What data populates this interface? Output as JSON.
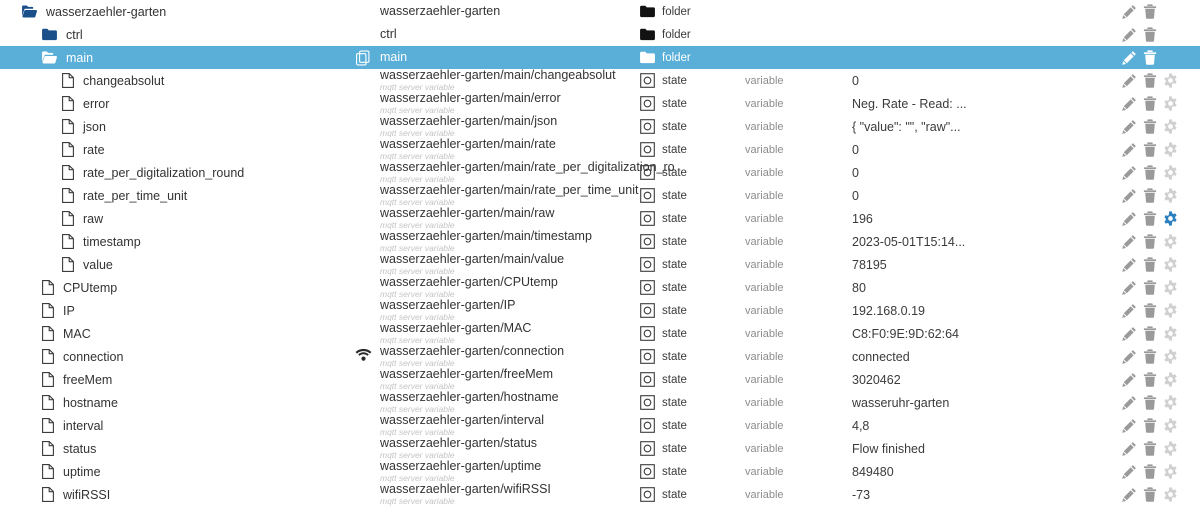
{
  "theme": {
    "selected_row_bg": "#5aafd8",
    "folder_icon_color": "#1b4f8a",
    "folder_icon_color_selected": "#ffffff",
    "action_icon_color": "#9a9a9a",
    "action_icon_active_color": "#2a7fbf",
    "subtitle_color": "#c4c4c4"
  },
  "labels": {
    "type_folder": "folder",
    "type_state": "state",
    "role_variable": "variable",
    "subtitle_mqtt": "mqtt server variable"
  },
  "icons": {
    "folder_open": "folder-open-icon",
    "folder_closed": "folder-closed-icon",
    "file": "file-icon",
    "copy": "copy-icon",
    "wifi": "wifi-icon",
    "state": "state-icon",
    "edit": "edit-pencil-icon",
    "delete": "trash-icon",
    "settings": "gear-icon"
  },
  "rows": [
    {
      "name": "wasserzaehler-garten",
      "id": "wasserzaehler-garten",
      "subtitle": "",
      "indent": 0,
      "node_icon": "folder-open-icon",
      "type": "folder",
      "role": "",
      "value": "",
      "selected": false,
      "has_settings": false,
      "settings_active": false,
      "leading_icon": ""
    },
    {
      "name": "ctrl",
      "id": "ctrl",
      "subtitle": "",
      "indent": 1,
      "node_icon": "folder-closed-icon",
      "type": "folder",
      "role": "",
      "value": "",
      "selected": false,
      "has_settings": false,
      "settings_active": false,
      "leading_icon": ""
    },
    {
      "name": "main",
      "id": "main",
      "subtitle": "",
      "indent": 1,
      "node_icon": "folder-open-icon",
      "type": "folder",
      "role": "",
      "value": "",
      "selected": true,
      "has_settings": false,
      "settings_active": false,
      "leading_icon": "copy-icon"
    },
    {
      "name": "changeabsolut",
      "id": "wasserzaehler-garten/main/changeabsolut",
      "subtitle": "mqtt server variable",
      "indent": 2,
      "node_icon": "file-icon",
      "type": "state",
      "role": "variable",
      "value": "0",
      "selected": false,
      "has_settings": true,
      "settings_active": false,
      "leading_icon": ""
    },
    {
      "name": "error",
      "id": "wasserzaehler-garten/main/error",
      "subtitle": "mqtt server variable",
      "indent": 2,
      "node_icon": "file-icon",
      "type": "state",
      "role": "variable",
      "value": "Neg. Rate - Read: ...",
      "selected": false,
      "has_settings": true,
      "settings_active": false,
      "leading_icon": ""
    },
    {
      "name": "json",
      "id": "wasserzaehler-garten/main/json",
      "subtitle": "mqtt server variable",
      "indent": 2,
      "node_icon": "file-icon",
      "type": "state",
      "role": "variable",
      "value": "{ \"value\": \"\", \"raw\"...",
      "selected": false,
      "has_settings": true,
      "settings_active": false,
      "leading_icon": ""
    },
    {
      "name": "rate",
      "id": "wasserzaehler-garten/main/rate",
      "subtitle": "mqtt server variable",
      "indent": 2,
      "node_icon": "file-icon",
      "type": "state",
      "role": "variable",
      "value": "0",
      "selected": false,
      "has_settings": true,
      "settings_active": false,
      "leading_icon": ""
    },
    {
      "name": "rate_per_digitalization_round",
      "id": "wasserzaehler-garten/main/rate_per_digitalization_ro",
      "subtitle": "mqtt server variable",
      "indent": 2,
      "node_icon": "file-icon",
      "type": "state",
      "role": "variable",
      "value": "0",
      "selected": false,
      "has_settings": true,
      "settings_active": false,
      "leading_icon": ""
    },
    {
      "name": "rate_per_time_unit",
      "id": "wasserzaehler-garten/main/rate_per_time_unit",
      "subtitle": "mqtt server variable",
      "indent": 2,
      "node_icon": "file-icon",
      "type": "state",
      "role": "variable",
      "value": "0",
      "selected": false,
      "has_settings": true,
      "settings_active": false,
      "leading_icon": ""
    },
    {
      "name": "raw",
      "id": "wasserzaehler-garten/main/raw",
      "subtitle": "mqtt server variable",
      "indent": 2,
      "node_icon": "file-icon",
      "type": "state",
      "role": "variable",
      "value": "196",
      "selected": false,
      "has_settings": true,
      "settings_active": true,
      "leading_icon": ""
    },
    {
      "name": "timestamp",
      "id": "wasserzaehler-garten/main/timestamp",
      "subtitle": "mqtt server variable",
      "indent": 2,
      "node_icon": "file-icon",
      "type": "state",
      "role": "variable",
      "value": "2023-05-01T15:14...",
      "selected": false,
      "has_settings": true,
      "settings_active": false,
      "leading_icon": ""
    },
    {
      "name": "value",
      "id": "wasserzaehler-garten/main/value",
      "subtitle": "mqtt server variable",
      "indent": 2,
      "node_icon": "file-icon",
      "type": "state",
      "role": "variable",
      "value": "78195",
      "selected": false,
      "has_settings": true,
      "settings_active": false,
      "leading_icon": ""
    },
    {
      "name": "CPUtemp",
      "id": "wasserzaehler-garten/CPUtemp",
      "subtitle": "mqtt server variable",
      "indent": 1,
      "node_icon": "file-icon",
      "type": "state",
      "role": "variable",
      "value": "80",
      "selected": false,
      "has_settings": true,
      "settings_active": false,
      "leading_icon": ""
    },
    {
      "name": "IP",
      "id": "wasserzaehler-garten/IP",
      "subtitle": "mqtt server variable",
      "indent": 1,
      "node_icon": "file-icon",
      "type": "state",
      "role": "variable",
      "value": "192.168.0.19",
      "selected": false,
      "has_settings": true,
      "settings_active": false,
      "leading_icon": ""
    },
    {
      "name": "MAC",
      "id": "wasserzaehler-garten/MAC",
      "subtitle": "mqtt server variable",
      "indent": 1,
      "node_icon": "file-icon",
      "type": "state",
      "role": "variable",
      "value": "C8:F0:9E:9D:62:64",
      "selected": false,
      "has_settings": true,
      "settings_active": false,
      "leading_icon": ""
    },
    {
      "name": "connection",
      "id": "wasserzaehler-garten/connection",
      "subtitle": "mqtt server variable",
      "indent": 1,
      "node_icon": "file-icon",
      "type": "state",
      "role": "variable",
      "value": "connected",
      "selected": false,
      "has_settings": true,
      "settings_active": false,
      "leading_icon": "wifi-icon"
    },
    {
      "name": "freeMem",
      "id": "wasserzaehler-garten/freeMem",
      "subtitle": "mqtt server variable",
      "indent": 1,
      "node_icon": "file-icon",
      "type": "state",
      "role": "variable",
      "value": "3020462",
      "selected": false,
      "has_settings": true,
      "settings_active": false,
      "leading_icon": ""
    },
    {
      "name": "hostname",
      "id": "wasserzaehler-garten/hostname",
      "subtitle": "mqtt server variable",
      "indent": 1,
      "node_icon": "file-icon",
      "type": "state",
      "role": "variable",
      "value": "wasseruhr-garten",
      "selected": false,
      "has_settings": true,
      "settings_active": false,
      "leading_icon": ""
    },
    {
      "name": "interval",
      "id": "wasserzaehler-garten/interval",
      "subtitle": "mqtt server variable",
      "indent": 1,
      "node_icon": "file-icon",
      "type": "state",
      "role": "variable",
      "value": "4,8",
      "selected": false,
      "has_settings": true,
      "settings_active": false,
      "leading_icon": ""
    },
    {
      "name": "status",
      "id": "wasserzaehler-garten/status",
      "subtitle": "mqtt server variable",
      "indent": 1,
      "node_icon": "file-icon",
      "type": "state",
      "role": "variable",
      "value": "Flow finished",
      "selected": false,
      "has_settings": true,
      "settings_active": false,
      "leading_icon": ""
    },
    {
      "name": "uptime",
      "id": "wasserzaehler-garten/uptime",
      "subtitle": "mqtt server variable",
      "indent": 1,
      "node_icon": "file-icon",
      "type": "state",
      "role": "variable",
      "value": "849480",
      "selected": false,
      "has_settings": true,
      "settings_active": false,
      "leading_icon": ""
    },
    {
      "name": "wifiRSSI",
      "id": "wasserzaehler-garten/wifiRSSI",
      "subtitle": "mqtt server variable",
      "indent": 1,
      "node_icon": "file-icon",
      "type": "state",
      "role": "variable",
      "value": "-73",
      "selected": false,
      "has_settings": true,
      "settings_active": false,
      "leading_icon": ""
    }
  ]
}
